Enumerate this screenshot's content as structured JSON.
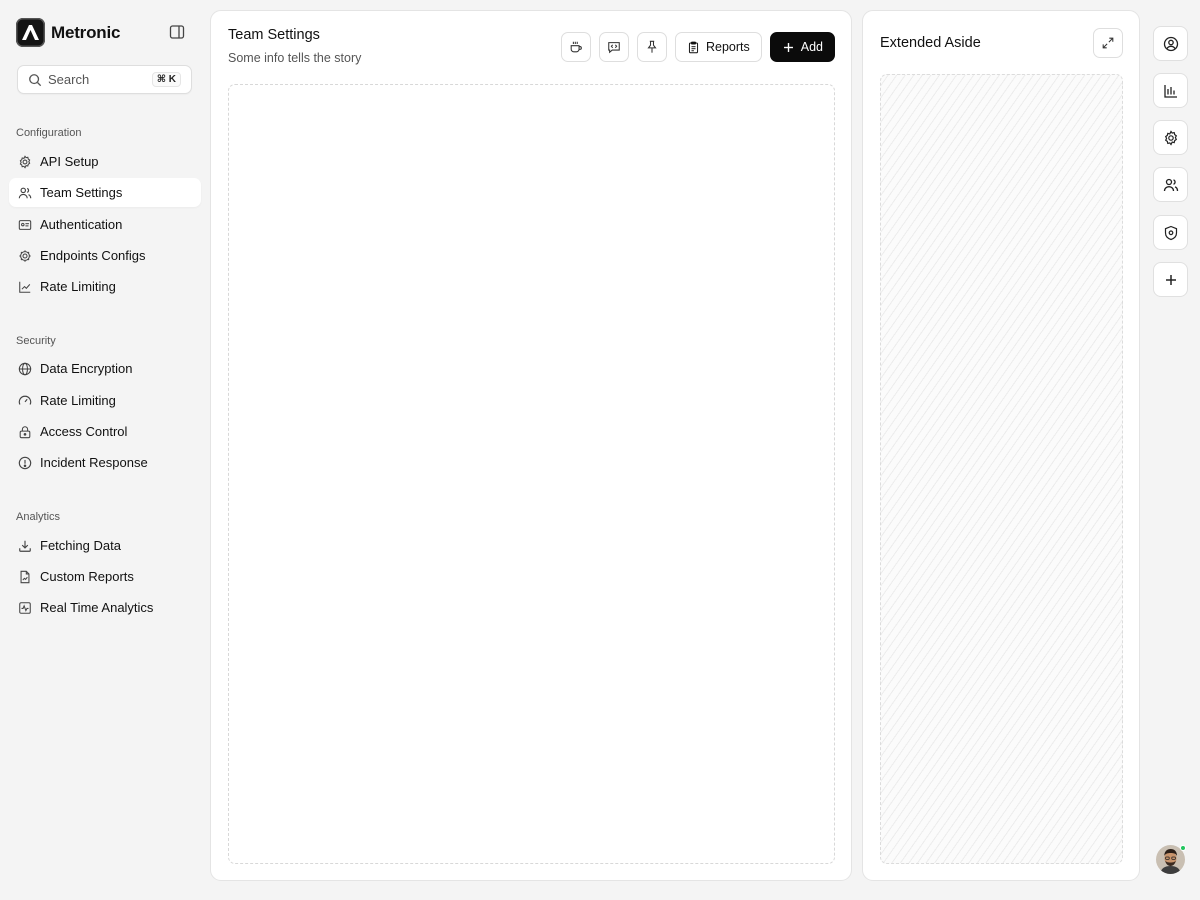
{
  "brand": {
    "name": "Metronic"
  },
  "search": {
    "placeholder": "Search",
    "shortcut": "⌘ K"
  },
  "sidebar": {
    "sections": [
      {
        "title": "Configuration",
        "items": [
          {
            "label": "API Setup",
            "icon": "gear-icon"
          },
          {
            "label": "Team Settings",
            "icon": "users-icon",
            "active": true
          },
          {
            "label": "Authentication",
            "icon": "id-card-icon"
          },
          {
            "label": "Endpoints Configs",
            "icon": "cog-icon"
          },
          {
            "label": "Rate Limiting",
            "icon": "line-chart-icon"
          }
        ]
      },
      {
        "title": "Security",
        "items": [
          {
            "label": "Data Encryption",
            "icon": "globe-icon"
          },
          {
            "label": "Rate Limiting",
            "icon": "gauge-icon"
          },
          {
            "label": "Access Control",
            "icon": "lock-icon"
          },
          {
            "label": "Incident Response",
            "icon": "alert-circle-icon"
          }
        ]
      },
      {
        "title": "Analytics",
        "items": [
          {
            "label": "Fetching Data",
            "icon": "download-icon"
          },
          {
            "label": "Custom Reports",
            "icon": "file-chart-icon"
          },
          {
            "label": "Real Time Analytics",
            "icon": "activity-icon"
          }
        ]
      }
    ]
  },
  "main": {
    "title": "Team Settings",
    "subtitle": "Some info tells the story",
    "toolbar": {
      "coffee_icon": "coffee-icon",
      "code_icon": "message-code-icon",
      "pin_icon": "pin-icon",
      "reports_label": "Reports",
      "add_label": "Add"
    }
  },
  "aside": {
    "title": "Extended Aside",
    "expand_icon": "expand-icon"
  },
  "rail": {
    "items": [
      "user-circle-icon",
      "bar-chart-icon",
      "settings-icon",
      "users-icon",
      "shield-icon",
      "plus-icon"
    ]
  },
  "colors": {
    "background": "#f4f4f4",
    "panel": "#ffffff",
    "primary_button": "#0b0b0b",
    "online_status": "#22c55e"
  }
}
